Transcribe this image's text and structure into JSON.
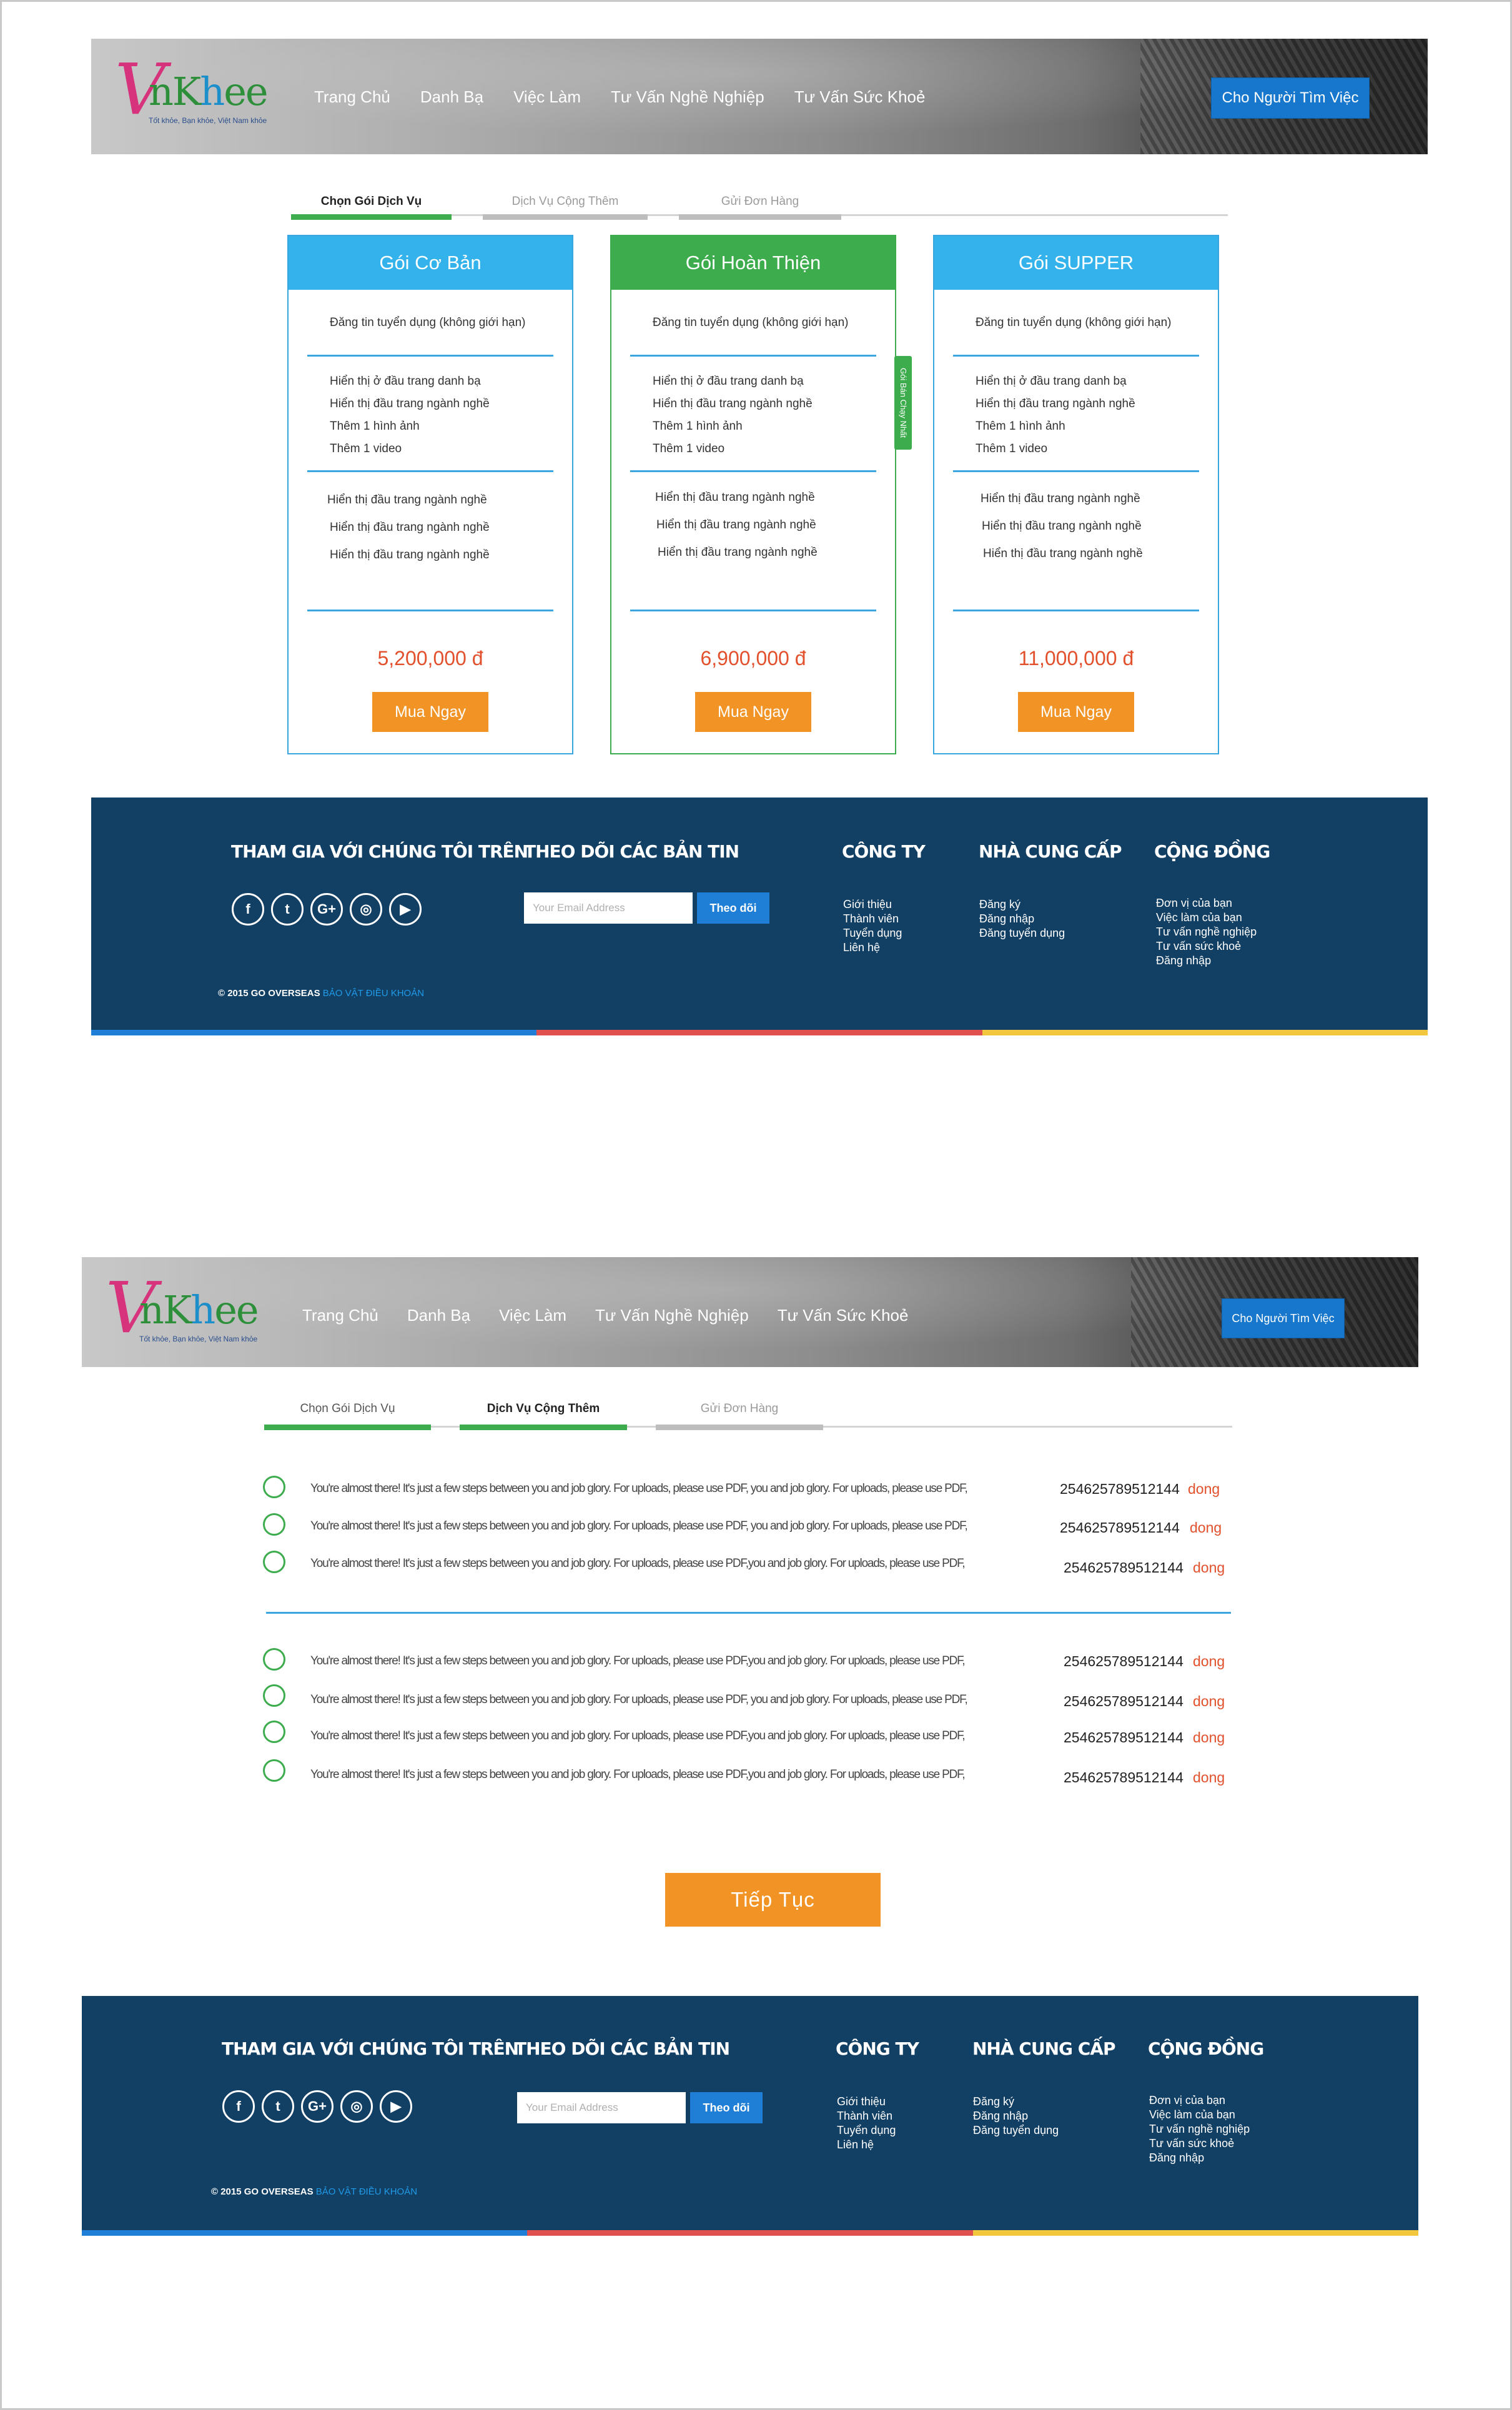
{
  "brand": {
    "logo_letters": "nKhee",
    "logo_letters_h": "h",
    "tagline": "Tốt khỏe, Bạn khỏe, Việt Nam khỏe"
  },
  "nav": [
    "Trang Chủ",
    "Danh Bạ",
    "Việc Làm",
    "Tư Vấn Nghề Nghiệp",
    "Tư Vấn Sức Khoẻ"
  ],
  "cta_top": "Cho Người Tìm Việc",
  "tabs": [
    "Chọn Gói Dịch Vụ",
    "Dịch Vụ Cộng Thêm",
    "Gửi Đơn Hàng"
  ],
  "packages": [
    {
      "name": "Gói Cơ Bản",
      "listing": "Đăng tin tuyển dụng (không giới hạn)",
      "features": [
        "Hiển thị ở đầu trang danh bạ",
        "Hiển thị đầu trang ngành nghề",
        "Thêm 1 hình ảnh",
        "Thêm 1 video"
      ],
      "extras": [
        "Hiển thị đầu trang ngành nghề",
        "Hiển thị đầu trang ngành nghề",
        "Hiển thị đầu trang ngành nghề"
      ],
      "price": "5,200,000 đ",
      "buy": "Mua Ngay"
    },
    {
      "name": "Gói Hoàn Thiện",
      "listing": "Đăng tin tuyển dụng (không giới hạn)",
      "features": [
        "Hiển thị ở đầu trang danh bạ",
        "Hiển thị đầu trang ngành nghề",
        "Thêm 1 hình ảnh",
        "Thêm 1 video"
      ],
      "extras": [
        "Hiển thị đầu trang ngành nghề",
        "Hiển thị đầu trang ngành nghề",
        "Hiển thị đầu trang ngành nghề"
      ],
      "price": "6,900,000 đ",
      "buy": "Mua Ngay",
      "ribbon": "Gói Bán Chạy Nhất"
    },
    {
      "name": "Gói SUPPER",
      "listing": "Đăng tin tuyển dụng (không giới hạn)",
      "features": [
        "Hiển thị ở đầu trang danh bạ",
        "Hiển thị đầu trang ngành nghề",
        "Thêm 1 hình ảnh",
        "Thêm 1 video"
      ],
      "extras": [
        "Hiển thị đầu trang ngành nghề",
        "Hiển thị đầu trang ngành nghề",
        "Hiển thị đầu trang ngành nghề"
      ],
      "price": "11,000,000 đ",
      "buy": "Mua Ngay"
    }
  ],
  "services": {
    "group1": [
      {
        "desc": "You're almost there! It's just a few steps between you and job glory. For uploads, please use PDF, you and job glory. For uploads, please use PDF,",
        "price": "254625789512144",
        "unit": "dong"
      },
      {
        "desc": "You're almost there! It's just a few steps between you and job glory. For uploads, please use PDF, you and job glory. For uploads, please use PDF,",
        "price": "254625789512144",
        "unit": "dong"
      },
      {
        "desc": "You're almost there! It's just a few steps between you and job glory. For uploads, please use PDF,you and job glory. For uploads, please use PDF,",
        "price": "254625789512144",
        "unit": "dong"
      }
    ],
    "group2": [
      {
        "desc": "You're almost there! It's just a few steps between you and job glory. For uploads, please use PDF,you and job glory. For uploads, please use PDF,",
        "price": "254625789512144",
        "unit": "dong"
      },
      {
        "desc": "You're almost there! It's just a few steps between you and job glory. For uploads, please use PDF, you and job glory. For uploads, please use PDF,",
        "price": "254625789512144",
        "unit": "dong"
      },
      {
        "desc": "You're almost there! It's just a few steps between you and job glory. For uploads, please use PDF,you and job glory. For uploads, please use PDF,",
        "price": "254625789512144",
        "unit": "dong"
      },
      {
        "desc": "You're almost there! It's just a few steps between you and job glory. For uploads, please use PDF,you and job glory. For uploads, please use PDF,",
        "price": "254625789512144",
        "unit": "dong"
      }
    ]
  },
  "continue": "Tiếp  Tục",
  "footer": {
    "join_title": "THAM GIA VỚI CHÚNG TÔI TRÊN",
    "social": [
      "f",
      "t",
      "G+",
      "◎",
      "▶"
    ],
    "newsletter_title": "THEO DÕI CÁC BẢN TIN",
    "email_placeholder": "Your Email Address",
    "subscribe": "Theo dõi",
    "company_title": "CÔNG TY",
    "company_links": [
      "Giới thiệu",
      "Thành viên",
      "Tuyển dụng",
      "Liên hệ"
    ],
    "supplier_title": "NHÀ CUNG CẤP",
    "supplier_links": [
      "Đăng ký",
      "Đăng nhập",
      "Đăng tuyển dụng"
    ],
    "community_title": "CỘNG ĐỒNG",
    "community_links": [
      "Đơn vị của bạn",
      "Việc làm của bạn",
      "Tư vấn nghề nghiệp",
      "Tư vấn sức khoẻ",
      "Đăng nhập"
    ],
    "copyright": "© 2015 GO OVERSEAS",
    "terms": "BẢO VẬT ĐIỀU KHOẢN"
  },
  "colors": {
    "primary_blue": "#33b2ec",
    "green": "#3cac4c",
    "orange": "#f19325",
    "price_red": "#e2502c",
    "footer_bg": "#123f64",
    "stripe_blue": "#1f7ed6",
    "stripe_red": "#e0504e",
    "stripe_yellow": "#f3c73d"
  }
}
